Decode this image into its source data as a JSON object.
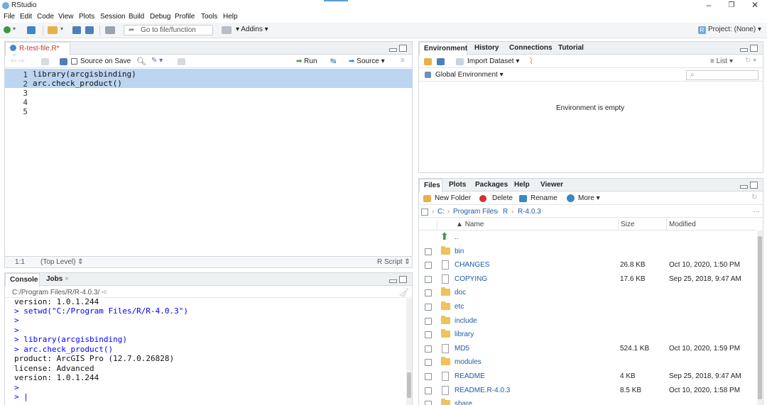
{
  "window": {
    "title": "RStudio"
  },
  "menu": [
    "File",
    "Edit",
    "Code",
    "View",
    "Plots",
    "Session",
    "Build",
    "Debug",
    "Profile",
    "Tools",
    "Help"
  ],
  "toolbar": {
    "goto_placeholder": "Go to file/function",
    "addins_label": "Addins",
    "project_label": "Project: (None)"
  },
  "editor": {
    "tab_label": "R-test-file.R*",
    "source_on_save_label": "Source on Save",
    "run_label": "Run",
    "source_label": "Source",
    "lines": [
      {
        "num": "1",
        "code": "library(arcgisbinding)"
      },
      {
        "num": "2",
        "code": "arc.check_product()"
      },
      {
        "num": "3",
        "code": ""
      },
      {
        "num": "4",
        "code": ""
      },
      {
        "num": "5",
        "code": ""
      }
    ],
    "status_position": "1:1",
    "status_scope": "(Top Level)",
    "status_type": "R Script"
  },
  "console": {
    "tabs": [
      "Console",
      "Jobs"
    ],
    "path": "C:/Program Files/R/R-4.0.3/",
    "lines": [
      {
        "kind": "out",
        "text": "version: 1.0.1.244"
      },
      {
        "kind": "in",
        "text": "> setwd(\"C:/Program Files/R/R-4.0.3\")"
      },
      {
        "kind": "in",
        "text": ">"
      },
      {
        "kind": "in",
        "text": ">"
      },
      {
        "kind": "in",
        "text": "> library(arcgisbinding)"
      },
      {
        "kind": "in",
        "text": "> arc.check_product()"
      },
      {
        "kind": "out",
        "text": "product: ArcGIS Pro (12.7.0.26828)"
      },
      {
        "kind": "out",
        "text": "license: Advanced"
      },
      {
        "kind": "out",
        "text": "version: 1.0.1.244"
      },
      {
        "kind": "in",
        "text": ">"
      },
      {
        "kind": "in",
        "text": "> |"
      }
    ]
  },
  "environment": {
    "tabs": [
      "Environment",
      "History",
      "Connections",
      "Tutorial"
    ],
    "import_dataset_label": "Import Dataset",
    "list_label": "List",
    "scope_label": "Global Environment",
    "empty_message": "Environment is empty"
  },
  "files": {
    "tabs": [
      "Files",
      "Plots",
      "Packages",
      "Help",
      "Viewer"
    ],
    "new_folder_label": "New Folder",
    "delete_label": "Delete",
    "rename_label": "Rename",
    "more_label": "More",
    "breadcrumb": [
      "C:",
      "Program Files",
      "R",
      "R-4.0.3"
    ],
    "columns": {
      "name": "Name",
      "size": "Size",
      "modified": "Modified"
    },
    "parent_label": "..",
    "rows": [
      {
        "name": "bin",
        "type": "folder",
        "size": "",
        "modified": ""
      },
      {
        "name": "CHANGES",
        "type": "file",
        "size": "26.8 KB",
        "modified": "Oct 10, 2020, 1:50 PM"
      },
      {
        "name": "COPYING",
        "type": "file",
        "size": "17.6 KB",
        "modified": "Sep 25, 2018, 9:47 AM"
      },
      {
        "name": "doc",
        "type": "folder",
        "size": "",
        "modified": ""
      },
      {
        "name": "etc",
        "type": "folder",
        "size": "",
        "modified": ""
      },
      {
        "name": "include",
        "type": "folder",
        "size": "",
        "modified": ""
      },
      {
        "name": "library",
        "type": "folder",
        "size": "",
        "modified": ""
      },
      {
        "name": "MD5",
        "type": "file",
        "size": "524.1 KB",
        "modified": "Oct 10, 2020, 1:59 PM"
      },
      {
        "name": "modules",
        "type": "folder",
        "size": "",
        "modified": ""
      },
      {
        "name": "README",
        "type": "file",
        "size": "4 KB",
        "modified": "Sep 25, 2018, 9:47 AM"
      },
      {
        "name": "README.R-4.0.3",
        "type": "file",
        "size": "8.5 KB",
        "modified": "Oct 10, 2020, 1:58 PM"
      },
      {
        "name": "share",
        "type": "folder",
        "size": "",
        "modified": ""
      }
    ]
  },
  "colors": {
    "selection": "#bcd5f1",
    "console_input": "#0000ff",
    "file_link": "#1c5ca8",
    "folder": "#f0c25b"
  }
}
